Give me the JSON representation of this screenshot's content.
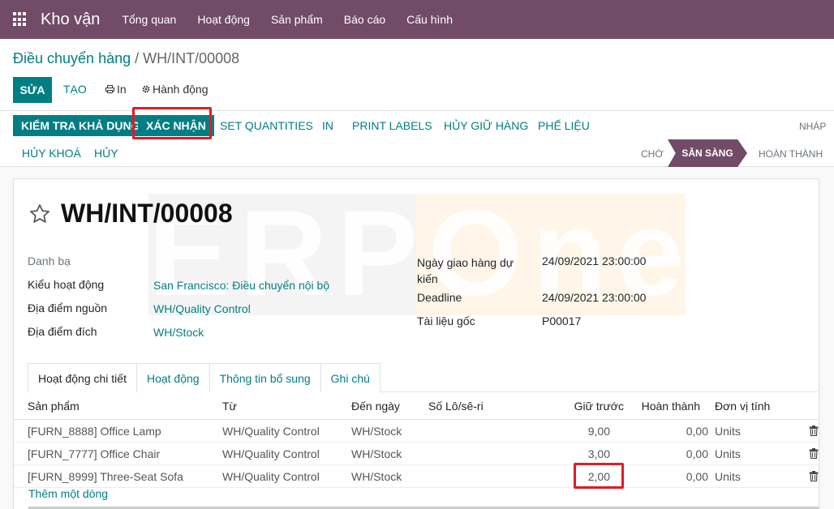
{
  "app": {
    "name": "Kho vận",
    "nav": [
      "Tổng quan",
      "Hoạt động",
      "Sản phẩm",
      "Báo cáo",
      "Cấu hình"
    ]
  },
  "breadcrumb": {
    "parent": "Điều chuyển hàng",
    "separator": "/",
    "current": "WH/INT/00008"
  },
  "toolbar": {
    "edit": "SỬA",
    "create": "TẠO",
    "print": "In",
    "action": "Hành động"
  },
  "actions": {
    "check_availability": "KIỂM TRA KHẢ DỤNG",
    "confirm": "XÁC NHẬN",
    "set_quantities": "SET QUANTITIES",
    "print": "IN",
    "print_labels": "PRINT LABELS",
    "unreserve": "HỦY GIỮ HÀNG",
    "scrap": "PHẾ LIỆU",
    "unlock": "HỦY KHOÁ",
    "cancel": "HỦY"
  },
  "stages": {
    "draft": "NHÁP",
    "waiting": "CHỜ",
    "ready": "SẴN SÀNG",
    "done": "HOÀN THÀNH"
  },
  "record": {
    "title": "WH/INT/00008",
    "left_fields": [
      {
        "label": "Danh bạ",
        "value": ""
      },
      {
        "label": "Kiểu hoạt động",
        "value": "San Francisco: Điều chuyển nội bộ"
      },
      {
        "label": "Địa điểm nguồn",
        "value": "WH/Quality Control"
      },
      {
        "label": "Địa điểm đích",
        "value": "WH/Stock"
      }
    ],
    "right_fields": [
      {
        "label": "Ngày giao hàng dự kiến",
        "value": "24/09/2021 23:00:00"
      },
      {
        "label": "Deadline",
        "value": "24/09/2021 23:00:00"
      },
      {
        "label": "Tài liệu gốc",
        "value": "P00017"
      }
    ]
  },
  "tabs": [
    "Hoạt động chi tiết",
    "Hoạt động",
    "Thông tin bổ sung",
    "Ghi chú"
  ],
  "table": {
    "columns": [
      "Sản phẩm",
      "Từ",
      "Đến ngày",
      "Số Lô/sê-ri",
      "Giữ trước",
      "Hoàn thành",
      "Đơn vị tính"
    ],
    "rows": [
      {
        "product": "[FURN_8888] Office Lamp",
        "from": "WH/Quality Control",
        "to": "WH/Stock",
        "lot": "",
        "reserved": "9,00",
        "done": "0,00",
        "uom": "Units"
      },
      {
        "product": "[FURN_7777] Office Chair",
        "from": "WH/Quality Control",
        "to": "WH/Stock",
        "lot": "",
        "reserved": "3,00",
        "done": "0,00",
        "uom": "Units"
      },
      {
        "product": "[FURN_8999] Three-Seat Sofa",
        "from": "WH/Quality Control",
        "to": "WH/Stock",
        "lot": "",
        "reserved": "2,00",
        "done": "0,00",
        "uom": "Units"
      }
    ],
    "add_line": "Thêm một dòng"
  },
  "watermark": {
    "left": "ERP",
    "right": "One"
  },
  "colors": {
    "brand": "#714b67",
    "primary": "#017e84",
    "highlight": "#e31b23"
  }
}
